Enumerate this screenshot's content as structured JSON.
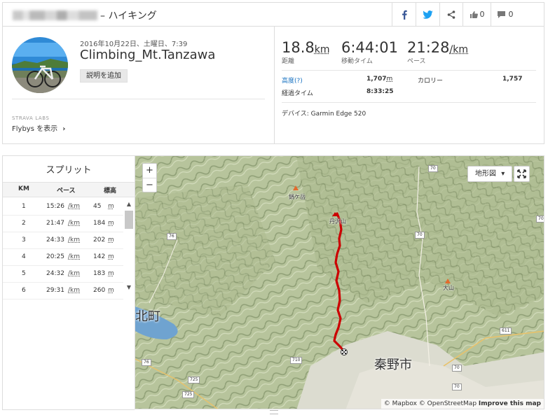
{
  "header": {
    "title_suffix": "– ハイキング",
    "kudos_count": "0",
    "comment_count": "0"
  },
  "activity": {
    "date": "2016年10月22日、土曜日、7:39",
    "name": "Climbing_Mt.Tanzawa",
    "add_description": "説明を追加",
    "labs_label": "STRAVA LABS",
    "flybys_label": "Flybys を表示",
    "flybys_chevron": "›"
  },
  "stats": {
    "distance": {
      "value": "18.8",
      "unit": "km",
      "label": "距離"
    },
    "moving_time": {
      "value": "6:44:01",
      "label": "移動タイム"
    },
    "pace": {
      "value": "21:28",
      "unit": "/km",
      "label": "ペース"
    },
    "elevation_label": "高度",
    "elevation_help": "(?)",
    "elevation_value": "1,707",
    "elevation_unit": "m",
    "calories_label": "カロリー",
    "calories_value": "1,757",
    "elapsed_label": "経過タイム",
    "elapsed_value": "8:33:25",
    "device_label": "デバイス:",
    "device_value": "Garmin Edge 520"
  },
  "splits": {
    "title": "スプリット",
    "col_km": "KM",
    "col_pace": "ペース",
    "col_elev": "標高",
    "rows": [
      {
        "km": "1",
        "pace": "15:26",
        "pace_unit": "/km",
        "elev": "45",
        "elev_unit": "m"
      },
      {
        "km": "2",
        "pace": "21:47",
        "pace_unit": "/km",
        "elev": "184",
        "elev_unit": "m"
      },
      {
        "km": "3",
        "pace": "24:33",
        "pace_unit": "/km",
        "elev": "202",
        "elev_unit": "m"
      },
      {
        "km": "4",
        "pace": "20:25",
        "pace_unit": "/km",
        "elev": "142",
        "elev_unit": "m"
      },
      {
        "km": "5",
        "pace": "24:32",
        "pace_unit": "/km",
        "elev": "183",
        "elev_unit": "m"
      },
      {
        "km": "6",
        "pace": "29:31",
        "pace_unit": "/km",
        "elev": "260",
        "elev_unit": "m"
      }
    ],
    "scroll_up": "▲",
    "scroll_down": "▼"
  },
  "map": {
    "zoom_in": "+",
    "zoom_out": "−",
    "map_type": "地形図",
    "map_type_caret": "▾",
    "attribution_mapbox": "© Mapbox",
    "attribution_osm": "© OpenStreetMap",
    "improve": "Improve this map",
    "labels": {
      "peak1": "鍋ケ岳",
      "peak2": "丹沢山",
      "peak3": "大山",
      "city_main": "秦野市",
      "city_left": "北町"
    },
    "shields": [
      "70",
      "76",
      "70",
      "70",
      "611",
      "76",
      "710",
      "725",
      "725",
      "70",
      "70"
    ],
    "route_color": "#cc0000"
  }
}
